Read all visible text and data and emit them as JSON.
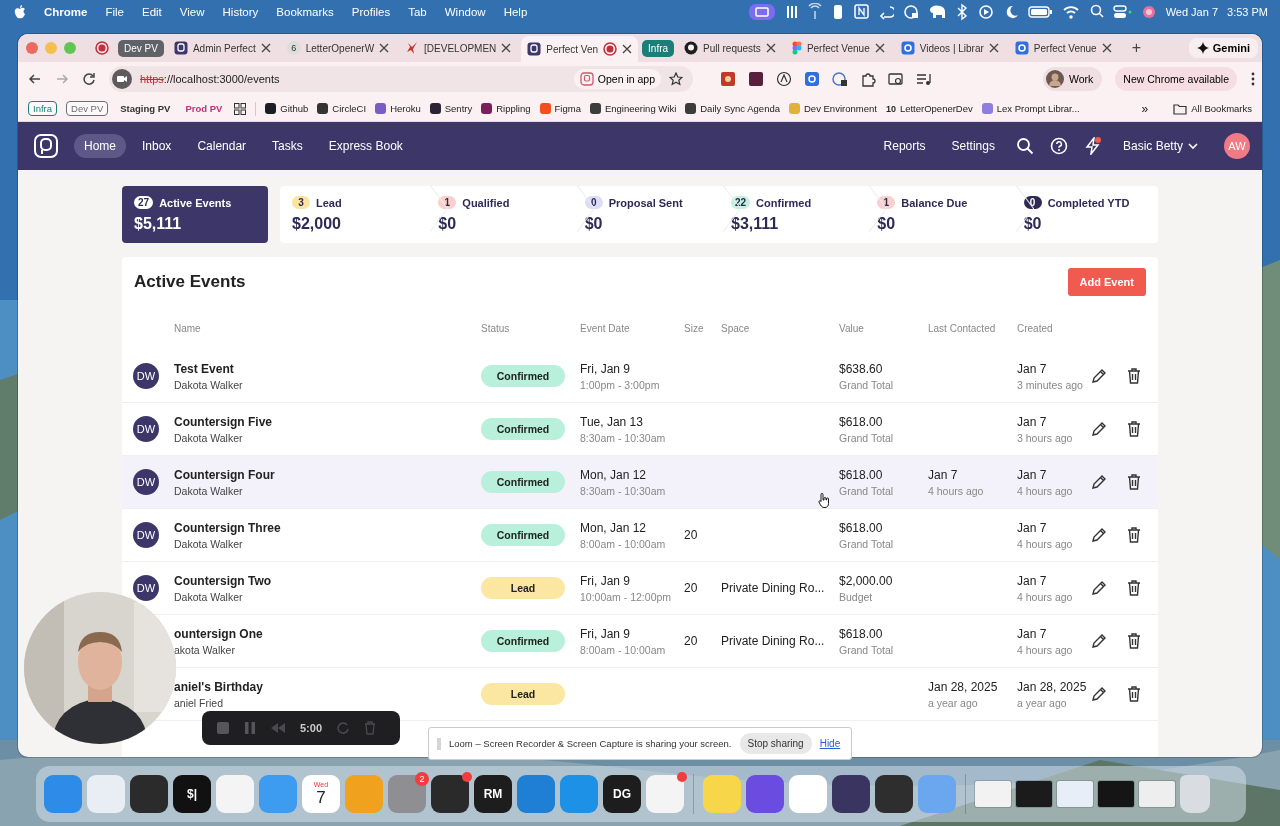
{
  "menubar": {
    "app": "Chrome",
    "items": [
      "File",
      "Edit",
      "View",
      "History",
      "Bookmarks",
      "Profiles",
      "Tab",
      "Window",
      "Help"
    ],
    "date": "Wed Jan 7",
    "time": "3:53 PM"
  },
  "browser": {
    "tabs": [
      {
        "kind": "pinned",
        "recording": true
      },
      {
        "kind": "group",
        "label": "Dev PV",
        "color": "#5f6368"
      },
      {
        "kind": "venue",
        "title": "Admin Perfect",
        "selected": false,
        "recording": false
      },
      {
        "kind": "count",
        "title": "LetterOpenerW",
        "icon_text": "6",
        "selected": false,
        "recording": false
      },
      {
        "kind": "mark",
        "title": "[DEVELOPMEN",
        "selected": false,
        "recording": false
      },
      {
        "kind": "venue",
        "title": "Perfect Ven",
        "selected": true,
        "recording": true
      },
      {
        "kind": "group",
        "label": "Infra",
        "color": "#1b7f79"
      },
      {
        "kind": "github",
        "title": "Pull requests",
        "selected": false,
        "recording": false
      },
      {
        "kind": "figma",
        "title": "Perfect Venue",
        "selected": false,
        "recording": false
      },
      {
        "kind": "square",
        "title": "Videos | Librar",
        "selected": false,
        "recording": false
      },
      {
        "kind": "square",
        "title": "Perfect Venue",
        "selected": false,
        "recording": false
      }
    ],
    "new_tab": "+",
    "gemini": "Gemini",
    "url": {
      "scheme": "https",
      "insecure": true,
      "rest": "://localhost:3000/events"
    },
    "open_in_app": "Open in app",
    "profile": "Work",
    "update": "New Chrome available",
    "bookmarks": [
      {
        "kind": "chip",
        "label": "Infra",
        "color": "#1b7f79"
      },
      {
        "kind": "chip",
        "label": "Dev PV",
        "color": "#6b6f75"
      },
      {
        "kind": "plain",
        "label": "Staging PV",
        "color": "#333333"
      },
      {
        "kind": "plain",
        "label": "Prod PV",
        "color": "#c0307a"
      },
      {
        "kind": "apps"
      },
      {
        "kind": "link",
        "label": "Github",
        "color": "#1b1f23"
      },
      {
        "kind": "link",
        "label": "CircleCI",
        "color": "#343434"
      },
      {
        "kind": "link",
        "label": "Heroku",
        "color": "#7b5cc4"
      },
      {
        "kind": "link",
        "label": "Sentry",
        "color": "#2b2233"
      },
      {
        "kind": "link",
        "label": "Rippling",
        "color": "#7a1f5c"
      },
      {
        "kind": "link",
        "label": "Figma",
        "color": "#f24e1e"
      },
      {
        "kind": "link",
        "label": "Engineering Wiki",
        "color": "#3c3c3c"
      },
      {
        "kind": "link",
        "label": "Daily Sync Agenda",
        "color": "#3c3c3c"
      },
      {
        "kind": "link",
        "label": "Dev Environment",
        "color": "#e0b23a"
      },
      {
        "kind": "link",
        "label": "LetterOpenerDev",
        "color": "#2a2a2a",
        "badge": "10"
      },
      {
        "kind": "link",
        "label": "Lex Prompt Librar...",
        "color": "#8f7ee0"
      }
    ],
    "more_bookmarks": "»",
    "all_bookmarks": "All Bookmarks"
  },
  "app": {
    "nav": [
      {
        "label": "Home",
        "selected": true
      },
      {
        "label": "Inbox",
        "selected": false
      },
      {
        "label": "Calendar",
        "selected": false
      },
      {
        "label": "Tasks",
        "selected": false
      },
      {
        "label": "Express Book",
        "selected": false
      }
    ],
    "right_links": [
      "Reports",
      "Settings"
    ],
    "notification": true,
    "user": "Basic Betty",
    "avatar": "AW",
    "stages": [
      {
        "count": "27",
        "label": "Active Events",
        "amount": "$5,111",
        "selected": true,
        "color": "#ffffff"
      },
      {
        "count": "3",
        "label": "Lead",
        "amount": "$2,000",
        "selected": false,
        "color": "#fbe3a0"
      },
      {
        "count": "1",
        "label": "Qualified",
        "amount": "$0",
        "selected": false,
        "color": "#f9d0cb"
      },
      {
        "count": "0",
        "label": "Proposal Sent",
        "amount": "$0",
        "selected": false,
        "color": "#dcdcf5"
      },
      {
        "count": "22",
        "label": "Confirmed",
        "amount": "$3,111",
        "selected": false,
        "color": "#c3f0df"
      },
      {
        "count": "1",
        "label": "Balance Due",
        "amount": "$0",
        "selected": false,
        "color": "#f9d0cb"
      },
      {
        "count": "0",
        "label": "Completed YTD",
        "amount": "$0",
        "selected": false,
        "color": "#2d2a55"
      }
    ],
    "title": "Active Events",
    "add_button": "Add Event",
    "columns": [
      "Name",
      "Status",
      "Event Date",
      "Size",
      "Space",
      "Value",
      "Last Contacted",
      "Created"
    ],
    "rows": [
      {
        "avatar": "DW",
        "name": "Test Event",
        "contact": "Dakota Walker",
        "status": {
          "label": "Confirmed",
          "color": "#b8f0dc"
        },
        "date": "Fri, Jan 9",
        "time": "1:00pm - 3:00pm",
        "value": "$638.60",
        "value_type": "Grand Total",
        "created": "Jan 7",
        "created_ago": "3 minutes ago",
        "highlighted": false
      },
      {
        "avatar": "DW",
        "name": "Countersign Five",
        "contact": "Dakota Walker",
        "status": {
          "label": "Confirmed",
          "color": "#b8f0dc"
        },
        "date": "Tue, Jan 13",
        "time": "8:30am - 10:30am",
        "value": "$618.00",
        "value_type": "Grand Total",
        "created": "Jan 7",
        "created_ago": "3 hours ago",
        "highlighted": false
      },
      {
        "avatar": "DW",
        "name": "Countersign Four",
        "contact": "Dakota Walker",
        "status": {
          "label": "Confirmed",
          "color": "#b8f0dc"
        },
        "date": "Mon, Jan 12",
        "time": "8:30am - 10:30am",
        "value": "$618.00",
        "value_type": "Grand Total",
        "last_contacted": "Jan 7",
        "last_contacted_ago": "4 hours ago",
        "created": "Jan 7",
        "created_ago": "4 hours ago",
        "highlighted": true
      },
      {
        "avatar": "DW",
        "name": "Countersign Three",
        "contact": "Dakota Walker",
        "status": {
          "label": "Confirmed",
          "color": "#b8f0dc"
        },
        "date": "Mon, Jan 12",
        "time": "8:00am - 10:00am",
        "size": "20",
        "value": "$618.00",
        "value_type": "Grand Total",
        "created": "Jan 7",
        "created_ago": "4 hours ago",
        "highlighted": false
      },
      {
        "avatar": "DW",
        "name": "Countersign Two",
        "contact": "Dakota Walker",
        "status": {
          "label": "Lead",
          "color": "#fbe7a1"
        },
        "date": "Fri, Jan 9",
        "time": "10:00am - 12:00pm",
        "size": "20",
        "space": "Private Dining Ro...",
        "value": "$2,000.00",
        "value_type": "Budget",
        "created": "Jan 7",
        "created_ago": "4 hours ago",
        "highlighted": false
      },
      {
        "name": "ountersign One",
        "contact": "akota Walker",
        "status": {
          "label": "Confirmed",
          "color": "#b8f0dc"
        },
        "date": "Fri, Jan 9",
        "time": "8:00am - 10:00am",
        "size": "20",
        "space": "Private Dining Ro...",
        "value": "$618.00",
        "value_type": "Grand Total",
        "created": "Jan 7",
        "created_ago": "4 hours ago",
        "highlighted": false
      },
      {
        "name": "aniel's Birthday",
        "contact": "aniel Fried",
        "status": {
          "label": "Lead",
          "color": "#fbe7a1"
        },
        "last_contacted": "Jan 28, 2025",
        "last_contacted_ago": "a year ago",
        "created": "Jan 28, 2025",
        "created_ago": "a year ago",
        "highlighted": false
      }
    ]
  },
  "recorder": {
    "time": "5:00"
  },
  "loom": {
    "message": "Loom – Screen Recorder & Screen Capture is sharing your screen.",
    "stop": "Stop sharing",
    "hide": "Hide"
  },
  "dock": [
    {
      "kind": "app",
      "color": "#2f8be8"
    },
    {
      "kind": "app",
      "color": "#e9eef5"
    },
    {
      "kind": "app",
      "color": "#2b2b2b"
    },
    {
      "kind": "text",
      "color": "#111111",
      "text": "$|"
    },
    {
      "kind": "app",
      "color": "#f4f4f4"
    },
    {
      "kind": "app",
      "color": "#3d9cf0"
    },
    {
      "kind": "calendar",
      "color": "#ffffff",
      "day": "Wed",
      "text": "7"
    },
    {
      "kind": "app",
      "color": "#f0a21e"
    },
    {
      "kind": "app",
      "color": "#8e8e93",
      "badge": "2"
    },
    {
      "kind": "app",
      "color": "#2a2a2a",
      "dot": true
    },
    {
      "kind": "text",
      "color": "#1d1d1d",
      "text": "RM"
    },
    {
      "kind": "app",
      "color": "#1f7fd4"
    },
    {
      "kind": "app",
      "color": "#1d91e6"
    },
    {
      "kind": "text",
      "color": "#1d1d1d",
      "text": "DG"
    },
    {
      "kind": "app",
      "color": "#f4f4f4",
      "dot": true
    },
    {
      "kind": "separator"
    },
    {
      "kind": "app",
      "color": "#f7d64a"
    },
    {
      "kind": "app",
      "color": "#6b4ce0"
    },
    {
      "kind": "app",
      "color": "#ffffff"
    },
    {
      "kind": "app",
      "color": "#3a3560"
    },
    {
      "kind": "app",
      "color": "#2e2e2e"
    },
    {
      "kind": "app",
      "color": "#6aa7ef"
    },
    {
      "kind": "separator"
    },
    {
      "kind": "thumbnail",
      "color": "#f2f2f2"
    },
    {
      "kind": "thumbnail",
      "color": "#1b1b1b"
    },
    {
      "kind": "thumbnail",
      "color": "#e8eef7"
    },
    {
      "kind": "thumbnail",
      "color": "#151515"
    },
    {
      "kind": "thumbnail",
      "color": "#eeeeee"
    },
    {
      "kind": "trash",
      "color": "#d9dde2"
    }
  ]
}
